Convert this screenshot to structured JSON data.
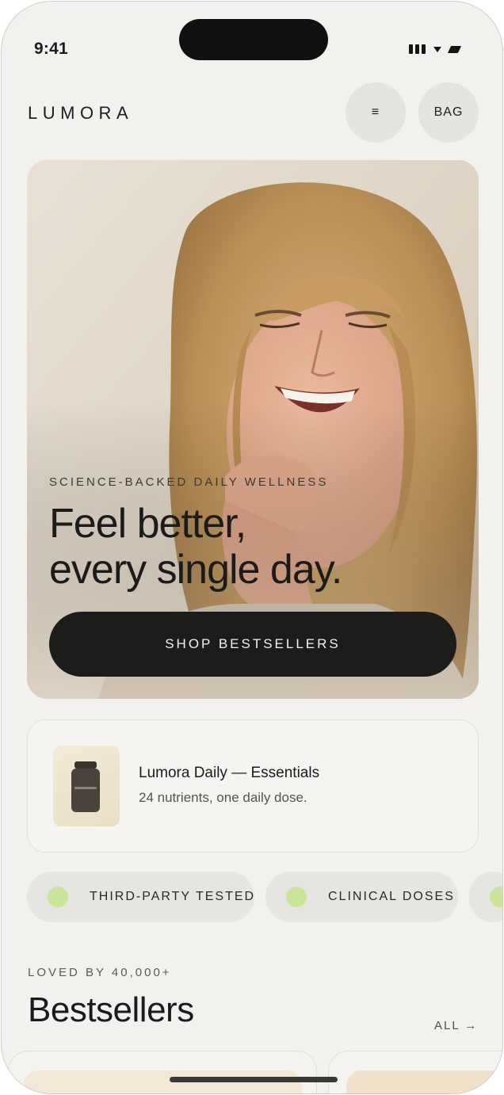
{
  "status_bar": {
    "time": "9:41"
  },
  "header": {
    "logo": "LUMORA",
    "menu_label": "≡",
    "bag_label": "BAG"
  },
  "hero": {
    "eyebrow": "SCIENCE-BACKED DAILY WELLNESS",
    "title_line1": "Feel better,",
    "title_line2": "every single day.",
    "cta_label": "SHOP BESTSELLERS"
  },
  "featured_product": {
    "name": "Lumora Daily — Essentials",
    "description": "24 nutrients, one daily dose."
  },
  "badges": [
    {
      "label": "THIRD-PARTY TESTED"
    },
    {
      "label": "CLINICAL DOSES"
    },
    {
      "label": ""
    }
  ],
  "bestsellers": {
    "eyebrow": "LOVED BY 40,000+",
    "title": "Bestsellers",
    "all_link": "ALL →"
  },
  "colors": {
    "background": "#f2f1ee",
    "accent_dot": "#c9e599",
    "cta_background": "#1c1c1a"
  }
}
